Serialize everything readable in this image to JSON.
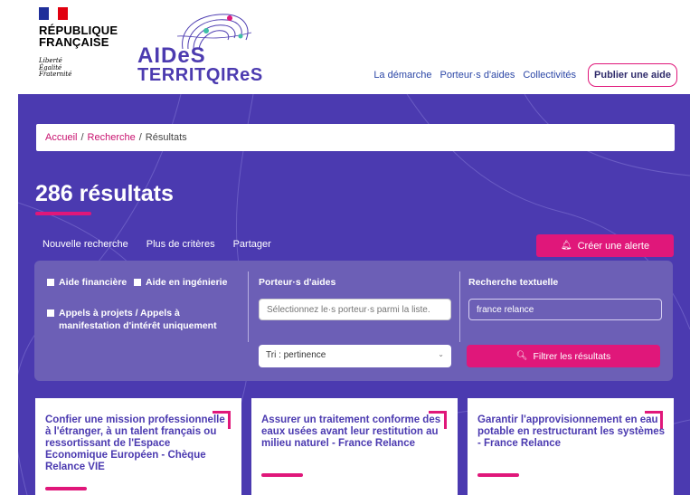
{
  "gov_logo": {
    "line1": "RÉPUBLIQUE",
    "line2": "FRANÇAISE",
    "motto": [
      "Liberté",
      "Égalité",
      "Fraternité"
    ]
  },
  "site_logo": {
    "word1": "AIDeS",
    "word2": "TERRITQIReS"
  },
  "nav": {
    "items": [
      "La démarche",
      "Porteur·s d'aides",
      "Collectivités"
    ],
    "publish": "Publier une aide"
  },
  "breadcrumb": {
    "home": "Accueil",
    "search": "Recherche",
    "current": "Résultats",
    "sep": "/"
  },
  "results": {
    "count": "286 résultats"
  },
  "actions": {
    "new_search": "Nouvelle recherche",
    "more_criteria": "Plus de critères",
    "share": "Partager",
    "alert": "Créer une alerte"
  },
  "filters": {
    "financial": "Aide financière",
    "engineering": "Aide en ingénierie",
    "calls": "Appels à projets / Appels à manifestation d'intérêt uniquement",
    "porteurs_label": "Porteur·s d'aides",
    "porteurs_placeholder": "Sélectionnez le·s porteur·s parmi la liste.",
    "text_label": "Recherche textuelle",
    "text_value": "france relance",
    "sort_value": "Tri : pertinence",
    "submit": "Filtrer les résultats"
  },
  "cards": [
    {
      "title": "Confier une mission professionnelle à l'étranger, à un talent français ou ressortissant de l'Espace Economique Européen - Chèque Relance VIE"
    },
    {
      "title": "Assurer un traitement conforme des eaux usées avant leur restitution au milieu naturel - France Relance"
    },
    {
      "title": "Garantir l'approvisionnement en eau potable en restructurant les systèmes - France Relance"
    }
  ],
  "colors": {
    "primary": "#4b3ab0",
    "accent": "#e0177a",
    "panel": "#6c5fb6"
  }
}
